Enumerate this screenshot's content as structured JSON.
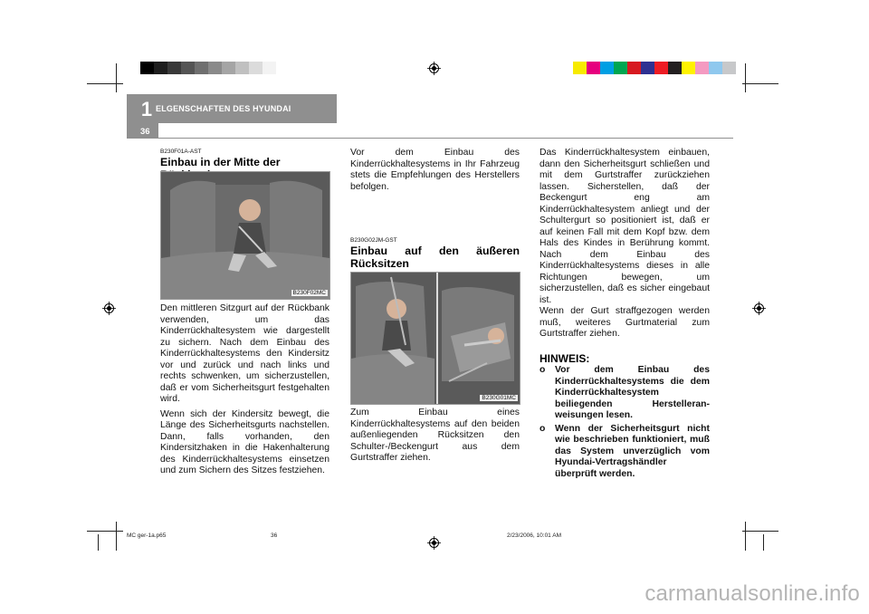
{
  "header": {
    "chapter_number": "1",
    "chapter_title": "ELGENSCHAFTEN DES HYUNDAI",
    "page_number": "36"
  },
  "colors": {
    "header_gray": "#8f8f8f",
    "gray_strip": [
      "#000000",
      "#1e1e1e",
      "#393939",
      "#545454",
      "#6f6f6f",
      "#8a8a8a",
      "#a5a5a5",
      "#c0c0c0",
      "#dbdbdb",
      "#f3f3f3"
    ],
    "color_strip": [
      "#f7ea00",
      "#e6007e",
      "#009fe3",
      "#00a651",
      "#d71920",
      "#2e3192",
      "#ed1c24",
      "#231f20",
      "#fff200",
      "#f49ac1",
      "#8fc8ee",
      "#c7c8ca"
    ]
  },
  "col1": {
    "code": "B230F01A-AST",
    "heading": "Einbau in der Mitte der Rückbank",
    "image_label": "B230F02MC",
    "para1": "Den mittleren Sitzgurt auf der Rückbank verwenden, um das Kinderrückhaltesystem wie dargestellt zu sichern. Nach dem Einbau des Kinderrückhaltesystems den Kindersitz vor und zurück und nach links und rechts schwenken, um sicherzustellen, daß er vom Sicherheitsgurt festgehalten wird.",
    "para2": "Wenn sich der Kindersitz bewegt, die Länge des Sicherheitsgurts nachstellen. Dann, falls vorhanden, den Kindersitzhaken in die Hakenhalterung des Kinderrückhaltesystems einsetzen und zum Sichern des Sitzes festziehen."
  },
  "col2": {
    "intro": "Vor dem Einbau des Kinderrückhaltesystems in Ihr Fahrzeug stets die Empfehlungen des Herstellers befolgen.",
    "code": "B230G02JM-GST",
    "heading": "Einbau auf den äußeren Rücksitzen",
    "image_label": "B230G01MC",
    "para": "Zum Einbau eines Kinderrückhaltesystems auf den beiden außenliegenden Rücksitzen den Schulter-/Beckengurt aus dem Gurtstraffer ziehen."
  },
  "col3": {
    "para1": "Das Kinderrückhaltesystem einbauen, dann den Sicherheitsgurt schließen und mit dem Gurtstraffer zurückziehen lassen. Sicherstellen, daß der Beckengurt eng am Kinderrückhaltesystem anliegt und der Schultergurt so positioniert ist, daß er auf keinen Fall mit dem Kopf bzw. dem Hals des Kindes in Berührung kommt. Nach dem Einbau des Kinderrückhaltesystems dieses in alle Richtungen bewegen, um sicherzustellen, daß es sicher eingebaut ist.",
    "para2": "Wenn der Gurt straffgezogen werden muß, weiteres Gurtmaterial zum Gurtstraffer ziehen.",
    "hinweis_title": "HINWEIS:",
    "hinweis_items": [
      {
        "bullet": "o",
        "text": "Vor dem Einbau des Kinderrückhaltesystems die dem Kinderrückhaltesystem beiliegenden Herstelleran-weisungen lesen."
      },
      {
        "bullet": "o",
        "text": "Wenn der Sicherheitsgurt nicht wie beschrieben funktioniert, muß das System unverzüglich vom Hyundai-Vertragshändler überprüft werden."
      }
    ]
  },
  "footer": {
    "file": "MC ger-1a.p65",
    "page": "36",
    "date": "2/23/2006, 10:01 AM"
  },
  "watermark": "carmanualsonline.info"
}
